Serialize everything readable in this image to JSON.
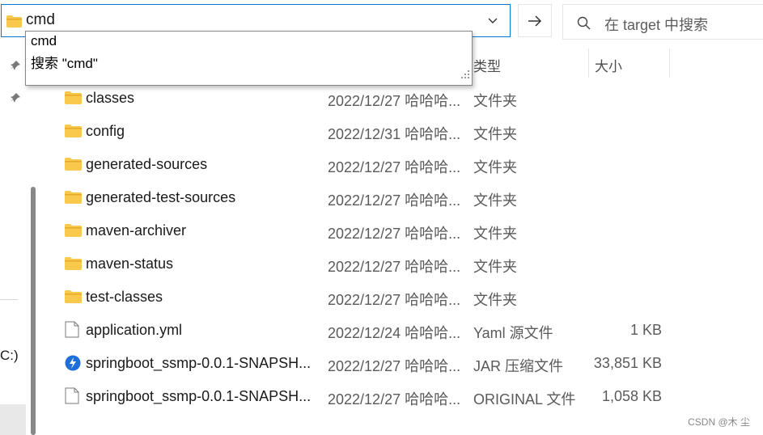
{
  "address_bar": {
    "value": "cmd",
    "icon": "folder-icon"
  },
  "autocomplete": {
    "items": [
      "cmd",
      "搜索 \"cmd\""
    ]
  },
  "search": {
    "placeholder": "在 target 中搜索"
  },
  "nav": {
    "drive_label": "C:)"
  },
  "columns": {
    "type": "类型",
    "size": "大小"
  },
  "files": [
    {
      "name": "classes",
      "date": "2022/12/27 哈哈哈...",
      "type": "文件夹",
      "size": "",
      "icon": "folder-icon"
    },
    {
      "name": "config",
      "date": "2022/12/31 哈哈哈...",
      "type": "文件夹",
      "size": "",
      "icon": "folder-icon"
    },
    {
      "name": "generated-sources",
      "date": "2022/12/27 哈哈哈...",
      "type": "文件夹",
      "size": "",
      "icon": "folder-icon"
    },
    {
      "name": "generated-test-sources",
      "date": "2022/12/27 哈哈哈...",
      "type": "文件夹",
      "size": "",
      "icon": "folder-icon"
    },
    {
      "name": "maven-archiver",
      "date": "2022/12/27 哈哈哈...",
      "type": "文件夹",
      "size": "",
      "icon": "folder-icon"
    },
    {
      "name": "maven-status",
      "date": "2022/12/27 哈哈哈...",
      "type": "文件夹",
      "size": "",
      "icon": "folder-icon"
    },
    {
      "name": "test-classes",
      "date": "2022/12/27 哈哈哈...",
      "type": "文件夹",
      "size": "",
      "icon": "folder-icon"
    },
    {
      "name": "application.yml",
      "date": "2022/12/24 哈哈哈...",
      "type": "Yaml 源文件",
      "size": "1 KB",
      "icon": "file-icon"
    },
    {
      "name": "springboot_ssmp-0.0.1-SNAPSH...",
      "date": "2022/12/27 哈哈哈...",
      "type": "JAR 压缩文件",
      "size": "33,851 KB",
      "icon": "jar-icon"
    },
    {
      "name": "springboot_ssmp-0.0.1-SNAPSH...",
      "date": "2022/12/27 哈哈哈...",
      "type": "ORIGINAL 文件",
      "size": "1,058 KB",
      "icon": "file-icon"
    }
  ],
  "watermark": "CSDN @木 尘",
  "colors": {
    "accent": "#0078d4",
    "folder": "#f8c94c",
    "jar": "#1f6fd8"
  }
}
